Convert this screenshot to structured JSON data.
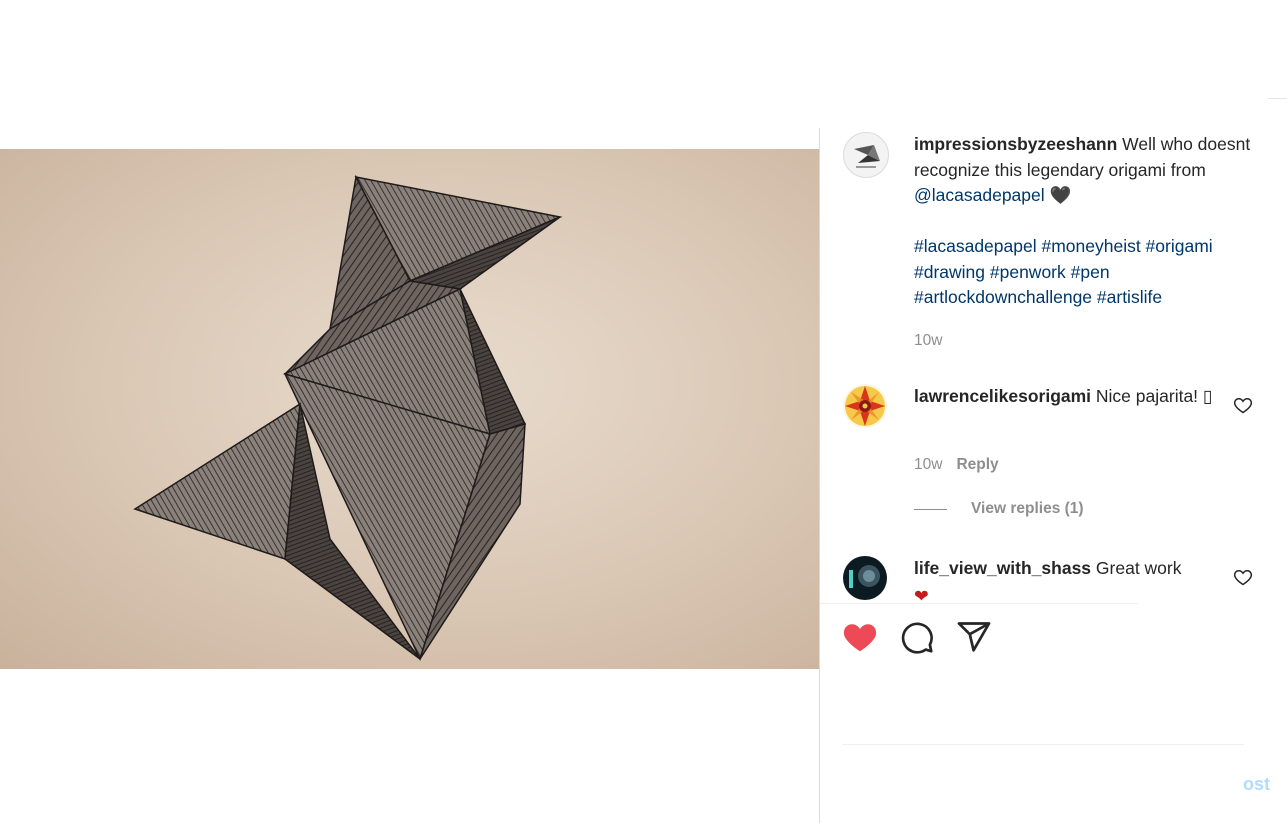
{
  "post": {
    "caption": {
      "username": "impressionsbyzeeshann",
      "text_line1": " Well who doesnt recognize this legendary origami from ",
      "mention": "@lacasadepapel",
      "emoji": " 🖤",
      "hashtags": "#lacasadepapel #moneyheist #origami #drawing #penwork #pen #artlockdownchallenge #artislife",
      "time": "10w"
    },
    "comments": [
      {
        "username": "lawrencelikesorigami",
        "text": " Nice pajarita! ▯",
        "time": "10w",
        "reply_label": "Reply",
        "view_replies": "View replies (1)"
      },
      {
        "username": "life_view_with_shass",
        "text": " Great work",
        "emoji": "❤"
      }
    ],
    "actions": {
      "like_icon": "heart-filled-icon",
      "comment_icon": "comment-icon",
      "share_icon": "paper-plane-icon",
      "like_color": "#ed4956"
    },
    "comment_box": {
      "post_label": "ost"
    }
  }
}
